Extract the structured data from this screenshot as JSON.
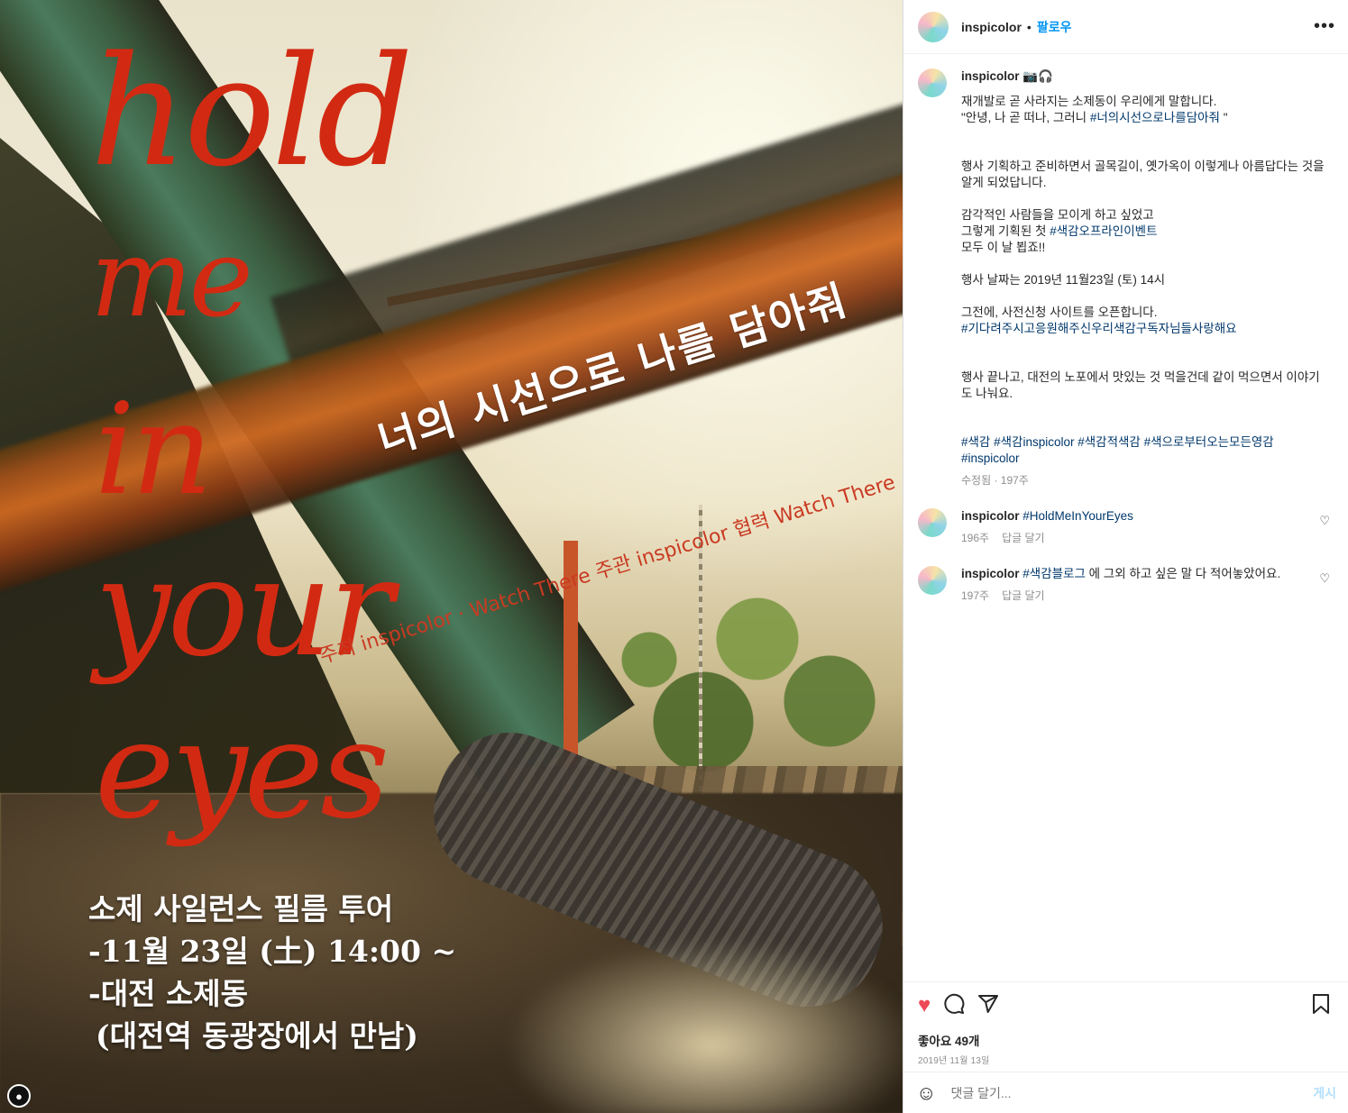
{
  "poster": {
    "script_words": [
      "hold",
      "me",
      "in",
      "your",
      "eyes"
    ],
    "banner_text": "너의 시선으로 나를 담아줘",
    "credits": "주최 inspicolor · Watch There   주관 inspicolor   협력 Watch There",
    "event_lines": [
      "소제 사일런스 필름 투어",
      "-11월 23일 (土) 14:00 ~",
      "-대전 소제동",
      "(대전역 동광장에서 만남)"
    ],
    "accent_color": "#d22a12"
  },
  "header": {
    "username": "inspicolor",
    "separator": "•",
    "follow_label": "팔로우",
    "more_icon": "more-horizontal-icon"
  },
  "caption": {
    "username": "inspicolor",
    "badge": "📷🎧",
    "line1": "재개발로 곧 사라지는 소제동이 우리에게 말합니다.",
    "line2_pre": "\"안녕, 나 곧 떠나, 그러니 ",
    "line2_tag": "#너의시선으로나를담아줘",
    "line2_post": " \"",
    "para2": "행사 기획하고 준비하면서 골목길이, 옛가옥이 이렇게나 아름답다는 것을 알게 되었답니다.",
    "para3_l1": "감각적인 사람들을 모이게 하고 싶었고",
    "para3_l2_pre": "그렇게 기획된 첫 ",
    "para3_l2_tag": "#색감오프라인이벤트",
    "para3_l3": "모두 이 날 뵙죠!!",
    "para4": "행사 날짜는 2019년 11월23일 (토) 14시",
    "para5_l1": "그전에, 사전신청 사이트를 오픈합니다.",
    "para5_tag": "#기다려주시고응원해주신우리색감구독자님들사랑해요",
    "para6": "행사 끝나고, 대전의 노포에서 맛있는 것 먹을건데 같이 먹으면서 이야기도 나눠요.",
    "hashtags": "#색감 #색감inspicolor #색감적색감 #색으로부터오는모든영감 #inspicolor",
    "meta": "수정됨 · 197주"
  },
  "comments": [
    {
      "username": "inspicolor",
      "text_tag": "#HoldMeInYourEyes",
      "text_post": "",
      "age": "196주",
      "reply": "답글 달기"
    },
    {
      "username": "inspicolor",
      "text_tag": "#색감블로그",
      "text_post": " 에 그외 하고 싶은 말 다 적어놓았어요.",
      "age": "197주",
      "reply": "답글 달기"
    }
  ],
  "actions": {
    "likes": "좋아요 49개",
    "date": "2019년 11월 13일",
    "like_color": "#ed4956"
  },
  "add_comment": {
    "placeholder": "댓글 달기...",
    "post_label": "게시"
  }
}
